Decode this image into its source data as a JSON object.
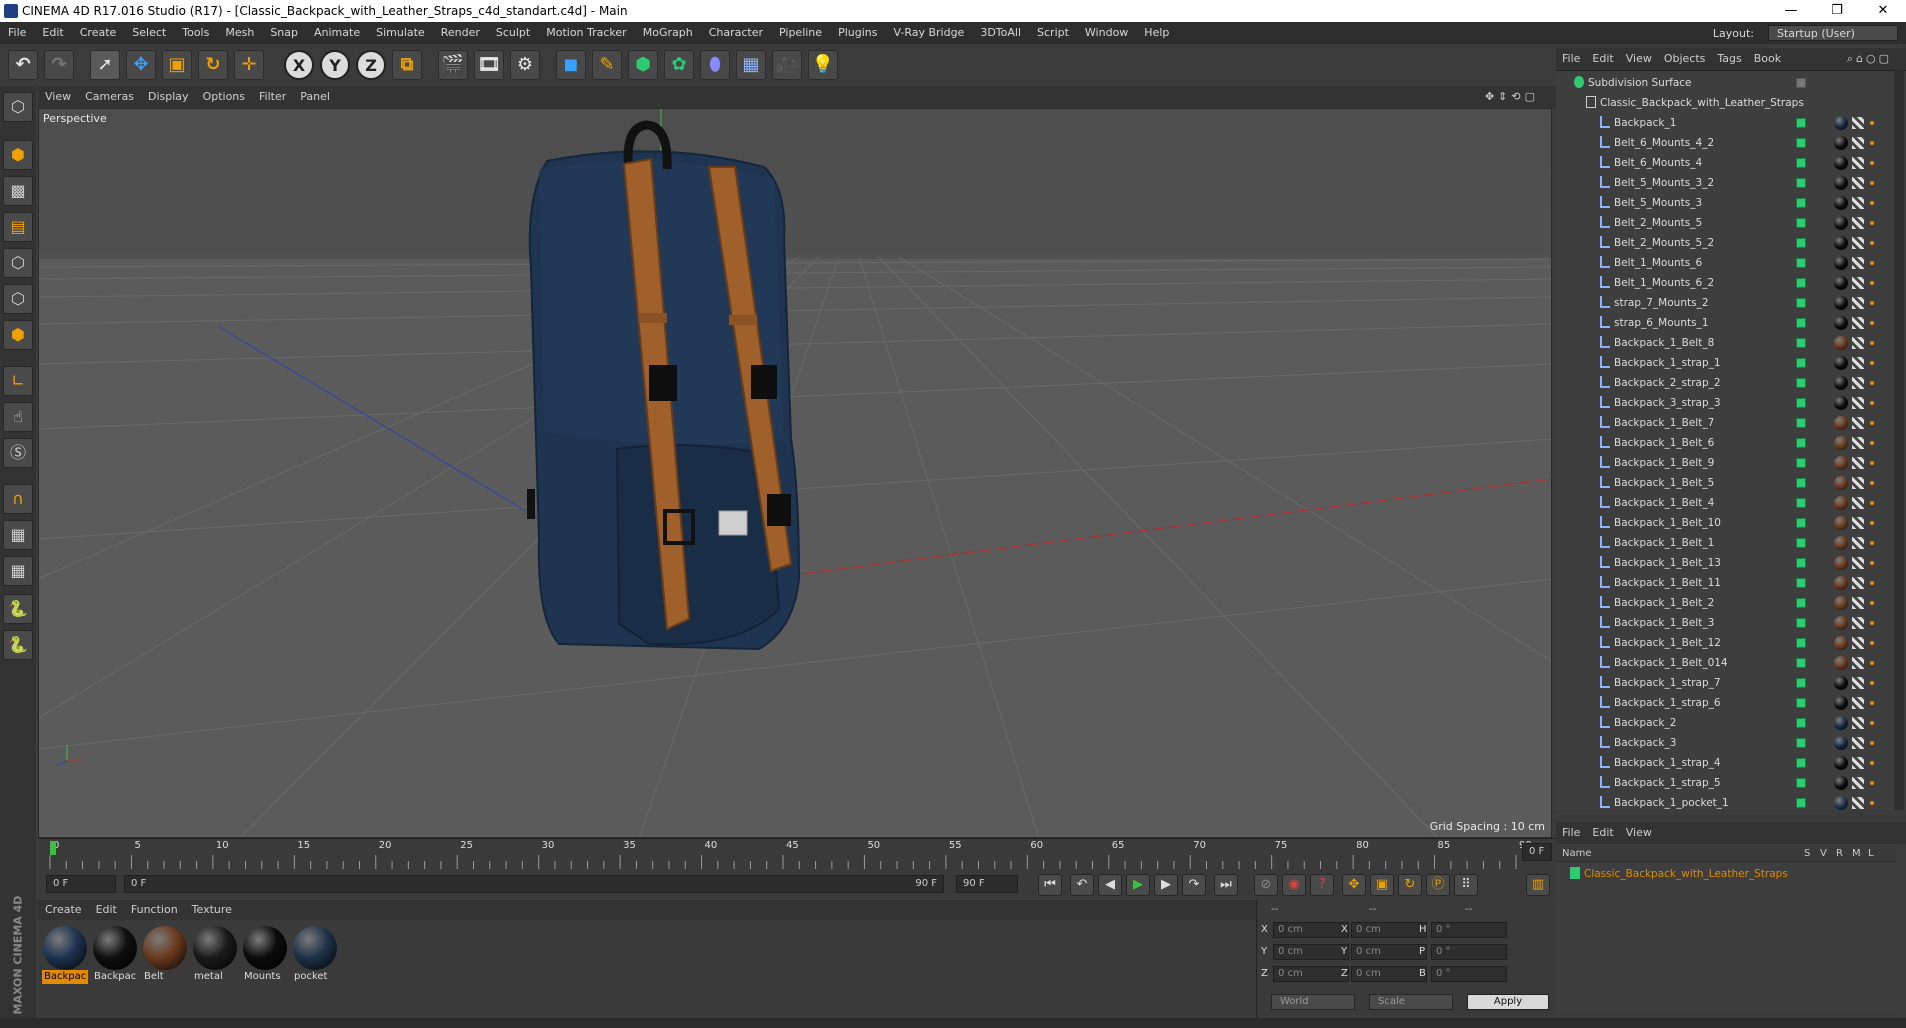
{
  "window": {
    "title": "CINEMA 4D R17.016 Studio (R17) - [Classic_Backpack_with_Leather_Straps_c4d_standart.c4d] - Main",
    "controls": [
      "—",
      "❐",
      "✕"
    ]
  },
  "menubar": {
    "items": [
      "File",
      "Edit",
      "Create",
      "Select",
      "Tools",
      "Mesh",
      "Snap",
      "Animate",
      "Simulate",
      "Render",
      "Sculpt",
      "Motion Tracker",
      "MoGraph",
      "Character",
      "Pipeline",
      "Plugins",
      "V-Ray Bridge",
      "3DToAll",
      "Script",
      "Window",
      "Help"
    ],
    "layout_label": "Layout:",
    "layout_value": "Startup (User)"
  },
  "viewport": {
    "menu": [
      "View",
      "Cameras",
      "Display",
      "Options",
      "Filter",
      "Panel"
    ],
    "label": "Perspective",
    "grid_spacing": "Grid Spacing : 10 cm"
  },
  "timeline": {
    "ticks": [
      "0",
      "5",
      "10",
      "15",
      "20",
      "25",
      "30",
      "35",
      "40",
      "45",
      "50",
      "55",
      "60",
      "65",
      "70",
      "75",
      "80",
      "85",
      "90"
    ],
    "current_frame": "0 F",
    "start_field": "0 F",
    "range_left": "0 F",
    "range_right": "90 F",
    "end_field": "90 F"
  },
  "materials": {
    "menu": [
      "Create",
      "Edit",
      "Function",
      "Texture"
    ],
    "items": [
      {
        "name": "Backpac",
        "color": "#1e3350",
        "selected": true
      },
      {
        "name": "Backpac",
        "color": "#0e0e0e",
        "selected": false
      },
      {
        "name": "Belt",
        "color": "#6a3a1e",
        "selected": false
      },
      {
        "name": "metal",
        "color": "#1a1a1a",
        "selected": false
      },
      {
        "name": "Mounts",
        "color": "#0b0b0b",
        "selected": false
      },
      {
        "name": "pocket",
        "color": "#1f3148",
        "selected": false
      }
    ],
    "brand": "MAXON CINEMA 4D"
  },
  "coordinates": {
    "header": [
      "--",
      "--",
      "--"
    ],
    "rows": [
      {
        "a": "X",
        "av": "0 cm",
        "b": "X",
        "bv": "0 cm",
        "c": "H",
        "cv": "0 °"
      },
      {
        "a": "Y",
        "av": "0 cm",
        "b": "Y",
        "bv": "0 cm",
        "c": "P",
        "cv": "0 °"
      },
      {
        "a": "Z",
        "av": "0 cm",
        "b": "Z",
        "bv": "0 cm",
        "c": "B",
        "cv": "0 °"
      }
    ],
    "space": "World",
    "mode": "Scale",
    "apply": "Apply"
  },
  "objects": {
    "menu": [
      "File",
      "Edit",
      "View",
      "Objects",
      "Tags",
      "Book"
    ],
    "root": "Subdivision Surface",
    "group": "Classic_Backpack_with_Leather_Straps",
    "items": [
      {
        "name": "Backpack_1",
        "tag": "#152840"
      },
      {
        "name": "Belt_6_Mounts_4_2",
        "tag": "#0c0c0c"
      },
      {
        "name": "Belt_6_Mounts_4",
        "tag": "#0c0c0c"
      },
      {
        "name": "Belt_5_Mounts_3_2",
        "tag": "#0c0c0c"
      },
      {
        "name": "Belt_5_Mounts_3",
        "tag": "#0c0c0c"
      },
      {
        "name": "Belt_2_Mounts_5",
        "tag": "#0c0c0c"
      },
      {
        "name": "Belt_2_Mounts_5_2",
        "tag": "#0c0c0c"
      },
      {
        "name": "Belt_1_Mounts_6",
        "tag": "#0c0c0c"
      },
      {
        "name": "Belt_1_Mounts_6_2",
        "tag": "#0c0c0c"
      },
      {
        "name": "strap_7_Mounts_2",
        "tag": "#0c0c0c"
      },
      {
        "name": "strap_6_Mounts_1",
        "tag": "#0c0c0c"
      },
      {
        "name": "Backpack_1_Belt_8",
        "tag": "#6a3a1e"
      },
      {
        "name": "Backpack_1_strap_1",
        "tag": "#0c0c0c"
      },
      {
        "name": "Backpack_2_strap_2",
        "tag": "#0c0c0c"
      },
      {
        "name": "Backpack_3_strap_3",
        "tag": "#0c0c0c"
      },
      {
        "name": "Backpack_1_Belt_7",
        "tag": "#6a3a1e"
      },
      {
        "name": "Backpack_1_Belt_6",
        "tag": "#6a3a1e"
      },
      {
        "name": "Backpack_1_Belt_9",
        "tag": "#6a3a1e"
      },
      {
        "name": "Backpack_1_Belt_5",
        "tag": "#6a3a1e"
      },
      {
        "name": "Backpack_1_Belt_4",
        "tag": "#6a3a1e"
      },
      {
        "name": "Backpack_1_Belt_10",
        "tag": "#6a3a1e"
      },
      {
        "name": "Backpack_1_Belt_1",
        "tag": "#6a3a1e"
      },
      {
        "name": "Backpack_1_Belt_13",
        "tag": "#6a3a1e"
      },
      {
        "name": "Backpack_1_Belt_11",
        "tag": "#6a3a1e"
      },
      {
        "name": "Backpack_1_Belt_2",
        "tag": "#6a3a1e"
      },
      {
        "name": "Backpack_1_Belt_3",
        "tag": "#6a3a1e"
      },
      {
        "name": "Backpack_1_Belt_12",
        "tag": "#6a3a1e"
      },
      {
        "name": "Backpack_1_Belt_014",
        "tag": "#6a3a1e"
      },
      {
        "name": "Backpack_1_strap_7",
        "tag": "#0c0c0c"
      },
      {
        "name": "Backpack_1_strap_6",
        "tag": "#0c0c0c"
      },
      {
        "name": "Backpack_2",
        "tag": "#152840"
      },
      {
        "name": "Backpack_3",
        "tag": "#152840"
      },
      {
        "name": "Backpack_1_strap_4",
        "tag": "#0c0c0c"
      },
      {
        "name": "Backpack_1_strap_5",
        "tag": "#0c0c0c"
      },
      {
        "name": "Backpack_1_pocket_1",
        "tag": "#1f3148"
      }
    ]
  },
  "attributes": {
    "menu": [
      "File",
      "Edit",
      "View"
    ],
    "columns": [
      "Name",
      "S",
      "V",
      "R",
      "M",
      "L"
    ],
    "item": "Classic_Backpack_with_Leather_Straps"
  },
  "colors": {
    "accent": "#e38a00",
    "check": "#2ecc71"
  }
}
